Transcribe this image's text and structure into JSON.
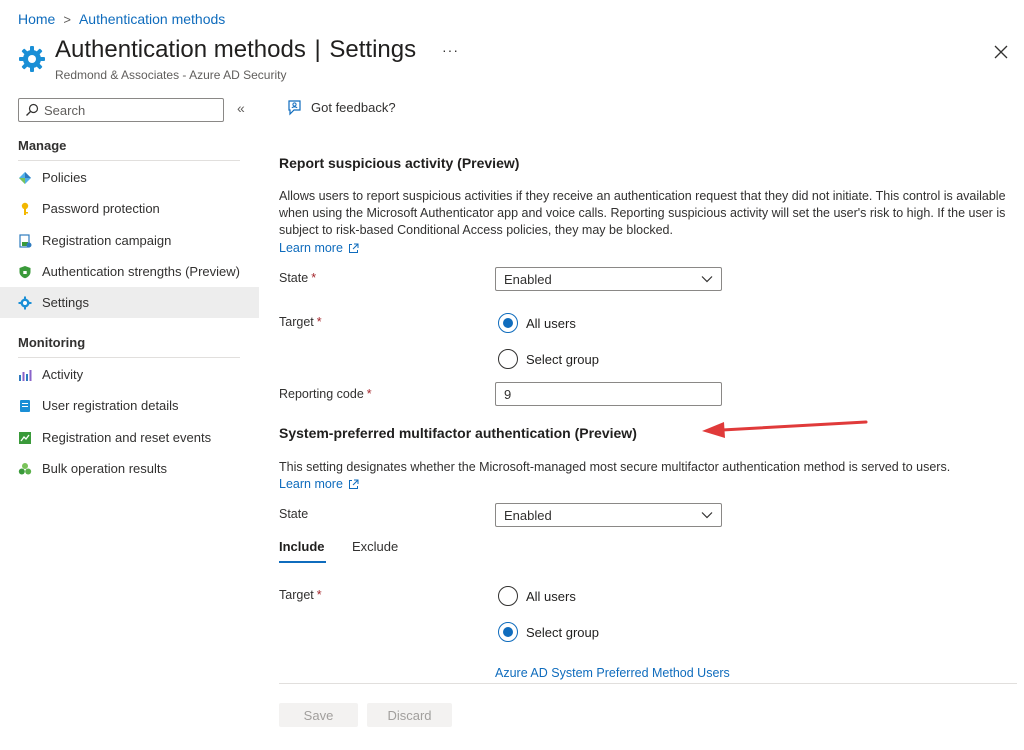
{
  "breadcrumb": {
    "home": "Home",
    "separator": ">",
    "current": "Authentication methods"
  },
  "header": {
    "title_main": "Authentication methods",
    "title_divider": "|",
    "title_section": "Settings",
    "more_label": "···",
    "subtitle": "Redmond & Associates - Azure AD Security"
  },
  "sidebar": {
    "search_placeholder": "Search",
    "collapse_label": "«",
    "manage_heading": "Manage",
    "manage_items": [
      {
        "label": "Policies",
        "icon": "policies-icon"
      },
      {
        "label": "Password protection",
        "icon": "key-icon"
      },
      {
        "label": "Registration campaign",
        "icon": "registration-campaign-icon"
      },
      {
        "label": "Authentication strengths (Preview)",
        "icon": "shield-icon"
      },
      {
        "label": "Settings",
        "icon": "gear-icon",
        "active": true
      }
    ],
    "monitoring_heading": "Monitoring",
    "monitoring_items": [
      {
        "label": "Activity",
        "icon": "activity-chart-icon"
      },
      {
        "label": "User registration details",
        "icon": "user-details-icon"
      },
      {
        "label": "Registration and reset events",
        "icon": "events-icon"
      },
      {
        "label": "Bulk operation results",
        "icon": "bulk-operation-icon"
      }
    ]
  },
  "toolbar": {
    "feedback_label": "Got feedback?"
  },
  "report_section": {
    "title": "Report suspicious activity (Preview)",
    "description": "Allows users to report suspicious activities if they receive an authentication request that they did not initiate. This control is available when using the Microsoft Authenticator app and voice calls. Reporting suspicious activity will set the user's risk to high. If the user is subject to risk-based Conditional Access policies, they may be blocked.",
    "learn_more": "Learn more",
    "state_label": "State",
    "required_mark": "*",
    "state_value": "Enabled",
    "target_label": "Target",
    "target_options": [
      "All users",
      "Select group"
    ],
    "target_selected": "All users",
    "reporting_code_label": "Reporting code",
    "reporting_code_value": "9"
  },
  "mfa_section": {
    "title": "System-preferred multifactor authentication (Preview)",
    "description": "This setting designates whether the Microsoft-managed most secure multifactor authentication method is served to users.",
    "learn_more": "Learn more",
    "state_label": "State",
    "state_value": "Enabled",
    "tabs": [
      "Include",
      "Exclude"
    ],
    "active_tab": "Include",
    "target_label": "Target",
    "required_mark": "*",
    "target_options": [
      "All users",
      "Select group"
    ],
    "target_selected": "Select group",
    "group_link": "Azure AD System Preferred Method Users"
  },
  "footer": {
    "save_label": "Save",
    "discard_label": "Discard"
  },
  "colors": {
    "accent": "#0f6cbd",
    "annotation_arrow": "#e03a3a",
    "active_nav": "#ededed"
  }
}
